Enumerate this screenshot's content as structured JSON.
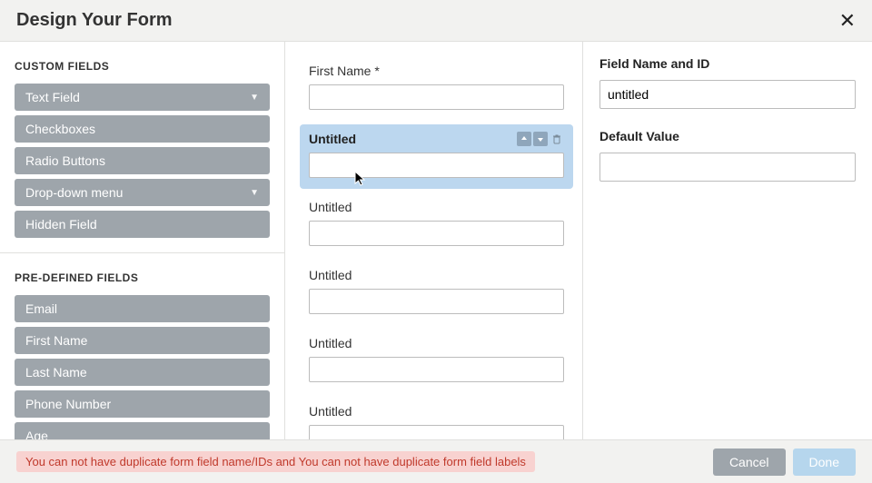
{
  "header": {
    "title": "Design Your Form"
  },
  "sidebar": {
    "custom_title": "CUSTOM FIELDS",
    "custom_fields": [
      {
        "label": "Text Field",
        "dropdown": true
      },
      {
        "label": "Checkboxes",
        "dropdown": false
      },
      {
        "label": "Radio Buttons",
        "dropdown": false
      },
      {
        "label": "Drop-down menu",
        "dropdown": true
      },
      {
        "label": "Hidden Field",
        "dropdown": false
      }
    ],
    "predefined_title": "PRE-DEFINED FIELDS",
    "predefined_fields": [
      {
        "label": "Email"
      },
      {
        "label": "First Name"
      },
      {
        "label": "Last Name"
      },
      {
        "label": "Phone Number"
      },
      {
        "label": "Age"
      }
    ]
  },
  "canvas": {
    "fields": [
      {
        "label": "First Name *",
        "selected": false
      },
      {
        "label": "Untitled",
        "selected": true
      },
      {
        "label": "Untitled",
        "selected": false
      },
      {
        "label": "Untitled",
        "selected": false
      },
      {
        "label": "Untitled",
        "selected": false
      },
      {
        "label": "Untitled",
        "selected": false
      }
    ]
  },
  "right": {
    "field_name_label": "Field Name and ID",
    "field_name_value": "untitled",
    "default_value_label": "Default Value",
    "default_value_value": ""
  },
  "footer": {
    "error": "You can not have duplicate form field name/IDs and You can not have duplicate form field labels",
    "cancel": "Cancel",
    "done": "Done"
  }
}
